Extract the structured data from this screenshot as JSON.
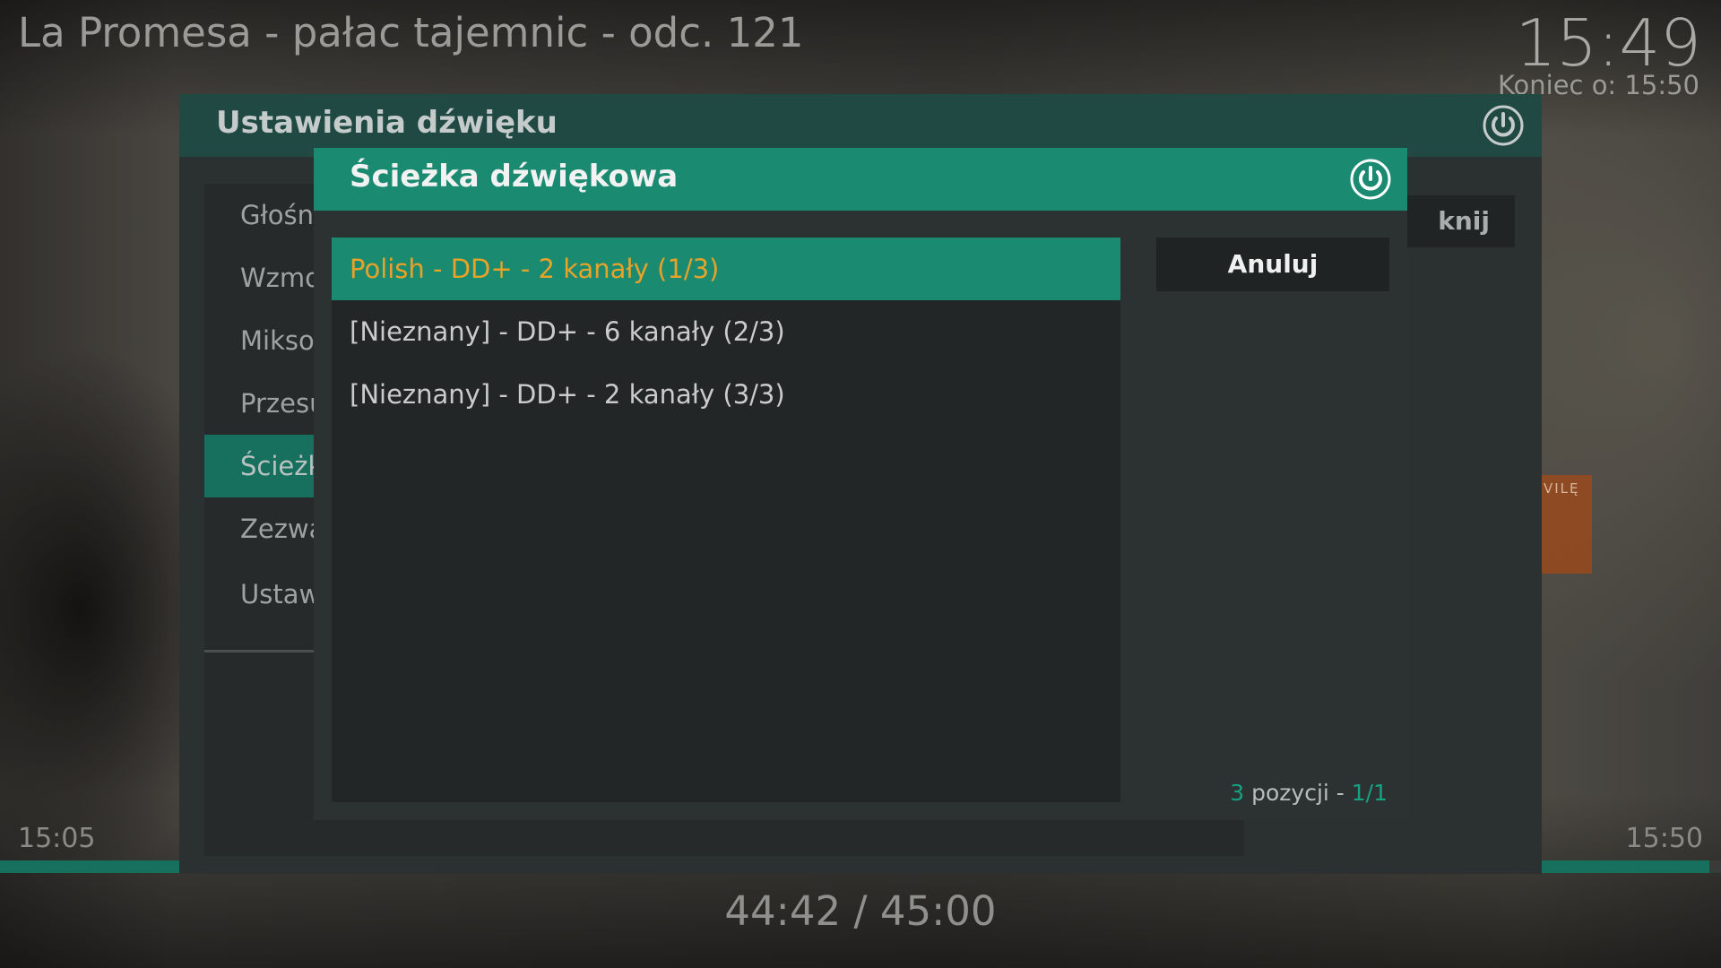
{
  "player": {
    "title": "La Promesa - pałac tajemnic - odc. 121",
    "clock": "15:49",
    "end_time": "Koniec o: 15:50",
    "start_time": "15:05",
    "stop_time": "15:50",
    "playtime": "44:42 / 45:00",
    "progress": 0.993,
    "background_tag_text": "VILĘ"
  },
  "audio_settings": {
    "title": "Ustawienia dźwięku",
    "items": [
      {
        "label": "Głośność"
      },
      {
        "label": "Wzmocnienie"
      },
      {
        "label": "Miksowanie"
      },
      {
        "label": "Przesunięcie"
      },
      {
        "label": "Ścieżka"
      },
      {
        "label": "Zezwalaj"
      },
      {
        "label": "Ustawienia"
      }
    ],
    "close_label": "knij",
    "power_icon": "power-icon"
  },
  "audio_stream_dialog": {
    "title": "Ścieżka dźwiękowa",
    "power_icon": "power-icon",
    "streams": [
      {
        "label": "Polish - DD+  - 2 kanały (1/3)"
      },
      {
        "label": "[Nieznany] - DD+  - 6 kanały (2/3)"
      },
      {
        "label": "[Nieznany] - DD+  - 2 kanały (3/3)"
      }
    ],
    "cancel_label": "Anuluj",
    "count": {
      "total": "3",
      "text": " pozycji - ",
      "page": "1/1"
    }
  },
  "colors": {
    "accent": "#1a8a71",
    "selected_text": "#e6a229",
    "header_dark": "#1f4942"
  }
}
